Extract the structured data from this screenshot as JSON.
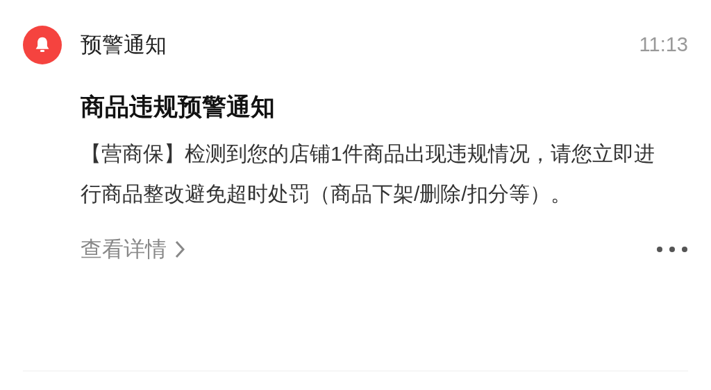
{
  "notification": {
    "app_name": "预警通知",
    "time": "11:13",
    "title": "商品违规预警通知",
    "body": "【营商保】检测到您的店铺1件商品出现违规情况，请您立即进行商品整改避免超时处罚（商品下架/删除/扣分等）。",
    "link": "查看详情"
  }
}
